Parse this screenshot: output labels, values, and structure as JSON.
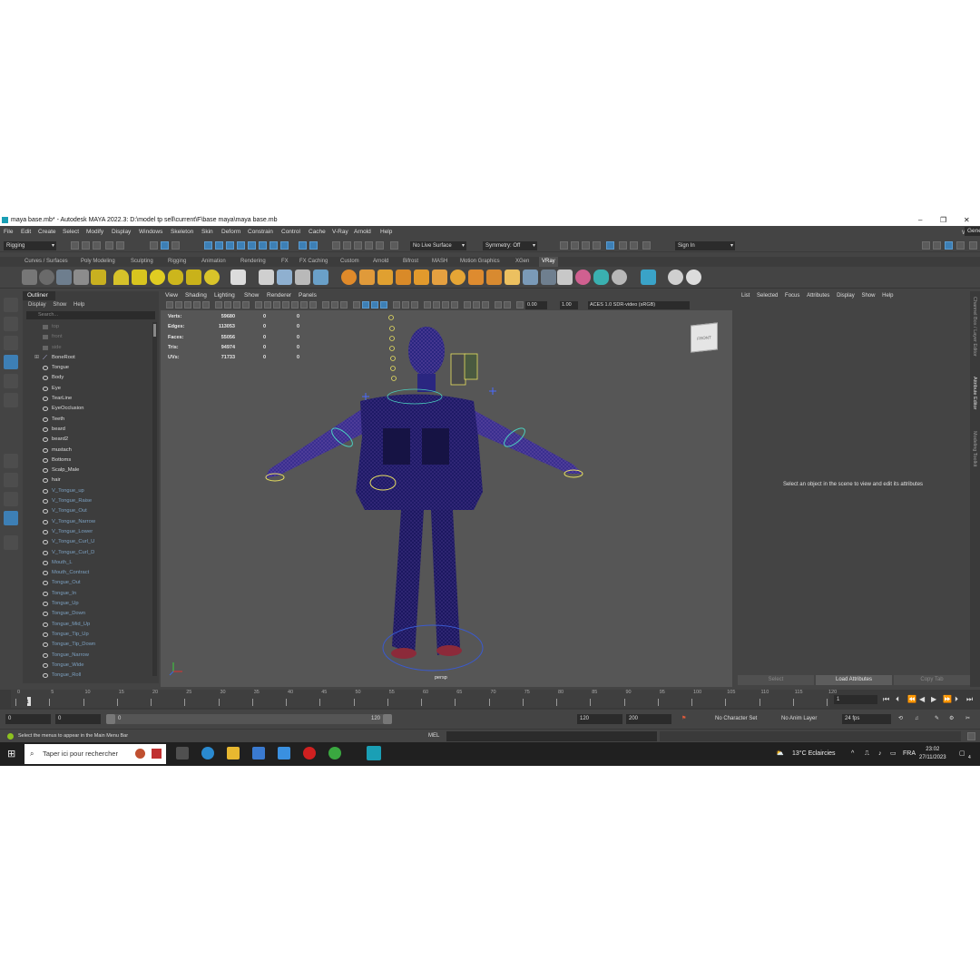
{
  "window": {
    "title": "maya base.mb* - Autodesk MAYA 2022.3: D:\\model tp sell\\current\\F\\base maya\\maya base.mb",
    "controls": [
      "–",
      "❐",
      "✕"
    ]
  },
  "menubar": {
    "items": [
      "File",
      "Edit",
      "Create",
      "Select",
      "Modify",
      "Display",
      "Windows",
      "Skeleton",
      "Skin",
      "Deform",
      "Constrain",
      "Control",
      "Cache",
      "V-Ray",
      "Arnold",
      "Help"
    ],
    "workspace_label": "Workspace:",
    "workspace_value": "General"
  },
  "statusline": {
    "menuset": "Rigging",
    "live_surface": "No Live Surface",
    "symmetry": "Symmetry: Off",
    "sign_in": "Sign In"
  },
  "shelf": {
    "tabs": [
      "Curves / Surfaces",
      "Poly Modeling",
      "Sculpting",
      "Rigging",
      "Animation",
      "Rendering",
      "FX",
      "FX Caching",
      "Custom",
      "Arnold",
      "Bifrost",
      "MASH",
      "Motion Graphics",
      "XGen",
      "VRay"
    ],
    "active_tab": "VRay"
  },
  "outliner": {
    "title": "Outliner",
    "menu": [
      "Display",
      "Show",
      "Help"
    ],
    "search_placeholder": "Search...",
    "items": [
      {
        "label": "top",
        "kind": "camera"
      },
      {
        "label": "front",
        "kind": "camera"
      },
      {
        "label": "side",
        "kind": "camera"
      },
      {
        "label": "BoneRoot",
        "kind": "joint"
      },
      {
        "label": "Tongue",
        "kind": "shape"
      },
      {
        "label": "Body",
        "kind": "shape"
      },
      {
        "label": "Eye",
        "kind": "shape"
      },
      {
        "label": "TearLine",
        "kind": "shape"
      },
      {
        "label": "EyeOcclusion",
        "kind": "shape"
      },
      {
        "label": "Teeth",
        "kind": "shape"
      },
      {
        "label": "beard",
        "kind": "shape"
      },
      {
        "label": "beard2",
        "kind": "shape"
      },
      {
        "label": "mustach",
        "kind": "shape"
      },
      {
        "label": "Bottoms",
        "kind": "shape"
      },
      {
        "label": "Scalp_Male",
        "kind": "shape"
      },
      {
        "label": "hair",
        "kind": "shape"
      },
      {
        "label": "V_Tongue_up",
        "kind": "blend"
      },
      {
        "label": "V_Tongue_Raise",
        "kind": "blend"
      },
      {
        "label": "V_Tongue_Out",
        "kind": "blend"
      },
      {
        "label": "V_Tongue_Narrow",
        "kind": "blend"
      },
      {
        "label": "V_Tongue_Lower",
        "kind": "blend"
      },
      {
        "label": "V_Tongue_Curl_U",
        "kind": "blend"
      },
      {
        "label": "V_Tongue_Curl_D",
        "kind": "blend"
      },
      {
        "label": "Mouth_L",
        "kind": "blend"
      },
      {
        "label": "Mouth_Contract",
        "kind": "blend"
      },
      {
        "label": "Tongue_Out",
        "kind": "blend"
      },
      {
        "label": "Tongue_In",
        "kind": "blend"
      },
      {
        "label": "Tongue_Up",
        "kind": "blend"
      },
      {
        "label": "Tongue_Down",
        "kind": "blend"
      },
      {
        "label": "Tongue_Mid_Up",
        "kind": "blend"
      },
      {
        "label": "Tongue_Tip_Up",
        "kind": "blend"
      },
      {
        "label": "Tongue_Tip_Down",
        "kind": "blend"
      },
      {
        "label": "Tongue_Narrow",
        "kind": "blend"
      },
      {
        "label": "Tongue_Wide",
        "kind": "blend"
      },
      {
        "label": "Tongue_Roll",
        "kind": "blend"
      }
    ]
  },
  "viewport": {
    "menu": [
      "View",
      "Shading",
      "Lighting",
      "Show",
      "Renderer",
      "Panels"
    ],
    "exposure": "0.00",
    "gamma": "1.00",
    "color_space": "ACES 1.0 SDR-video (sRGB)",
    "viewcube_label": "FRONT",
    "camera": "persp",
    "hud": [
      {
        "label": "Verts:",
        "v1": "59680",
        "v2": "0",
        "v3": "0"
      },
      {
        "label": "Edges:",
        "v1": "113053",
        "v2": "0",
        "v3": "0"
      },
      {
        "label": "Faces:",
        "v1": "55056",
        "v2": "0",
        "v3": "0"
      },
      {
        "label": "Tris:",
        "v1": "94974",
        "v2": "0",
        "v3": "0"
      },
      {
        "label": "UVs:",
        "v1": "71733",
        "v2": "0",
        "v3": "0"
      }
    ]
  },
  "attribute_editor": {
    "menu": [
      "List",
      "Selected",
      "Focus",
      "Attributes",
      "Display",
      "Show",
      "Help"
    ],
    "message": "Select an object in the scene to view and edit its attributes",
    "buttons": [
      "Select",
      "Load Attributes",
      "Copy Tab"
    ]
  },
  "side_tabs": [
    "Channel Box / Layer Editor",
    "Attribute Editor",
    "Modeling Toolkit"
  ],
  "timeline": {
    "ticks": [
      "0",
      "5",
      "10",
      "15",
      "20",
      "25",
      "30",
      "35",
      "40",
      "45",
      "50",
      "55",
      "60",
      "65",
      "70",
      "75",
      "80",
      "85",
      "90",
      "95",
      "100",
      "105",
      "110",
      "115",
      "120"
    ],
    "current_frame": "1",
    "current_frame_field": "1"
  },
  "range": {
    "start": "0",
    "playback_start": "0",
    "slider_left": "0",
    "slider_right": "120",
    "playback_end": "120",
    "end": "200",
    "character_set": "No Character Set",
    "anim_layer": "No Anim Layer",
    "fps": "24 fps"
  },
  "commandline": {
    "help_text": "Select the menus to appear in the Main Menu Bar",
    "mel_label": "MEL"
  },
  "taskbar": {
    "search_placeholder": "Taper ici pour rechercher",
    "weather": "13°C  Eclaircies",
    "lang": "FRA",
    "time": "23:02",
    "date": "27/11/2023",
    "notif_count": "4"
  }
}
